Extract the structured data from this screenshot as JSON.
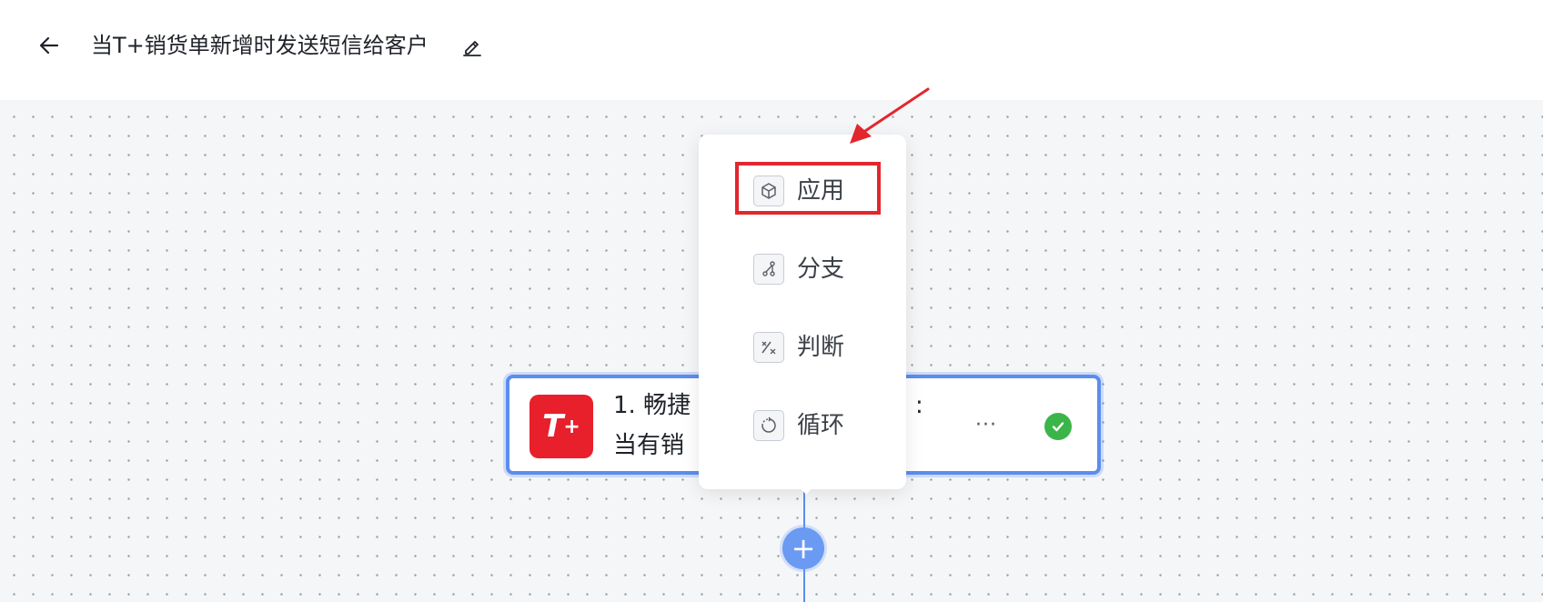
{
  "header": {
    "back_icon": "arrow-left-icon",
    "title": "当T+销货单新增时发送短信给客户",
    "edit_icon": "pencil-icon"
  },
  "trigger_card": {
    "app_logo_text": "T",
    "app_logo_sup": "+",
    "line1_visible": "1. 畅捷",
    "line1_tail": ":",
    "line2_visible": "当有销",
    "more_label": "···",
    "status_icon": "check-circle-icon",
    "accent_color": "#5b8def",
    "logo_color": "#e8202c",
    "status_color": "#3bb54a"
  },
  "add_node": {
    "label": "+"
  },
  "popover_menu": {
    "items": [
      {
        "label": "应用",
        "icon": "cube-icon"
      },
      {
        "label": "分支",
        "icon": "branch-icon"
      },
      {
        "label": "判断",
        "icon": "condition-icon"
      },
      {
        "label": "循环",
        "icon": "loop-icon"
      }
    ]
  },
  "annotation": {
    "highlight_color": "#e3262d",
    "highlighted_item": "应用"
  }
}
